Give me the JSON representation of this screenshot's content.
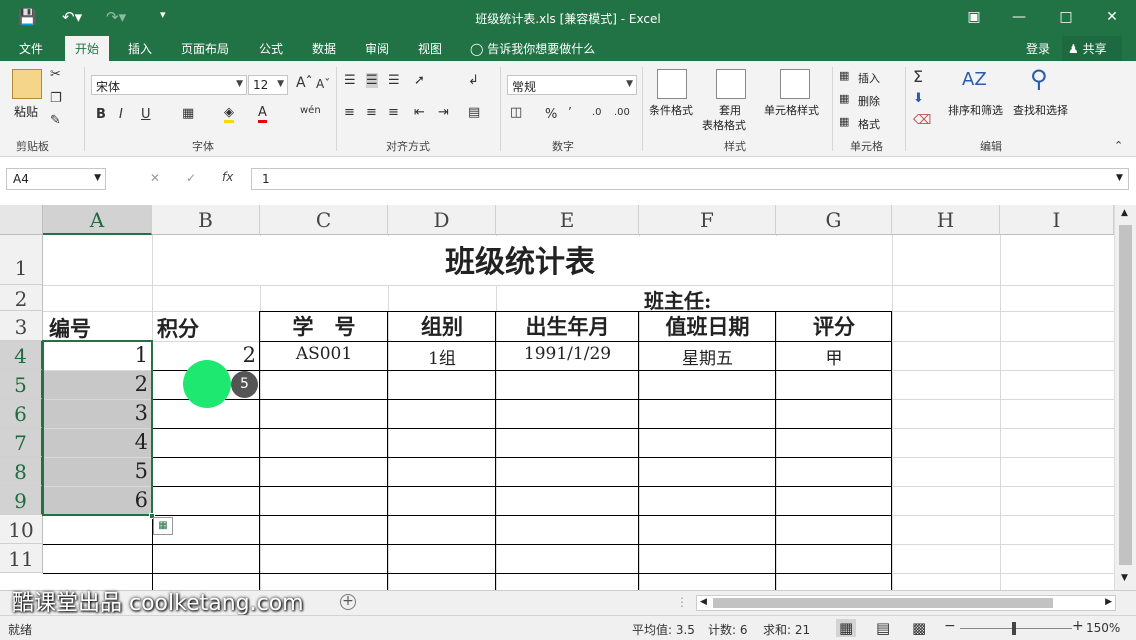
{
  "window": {
    "title": "班级统计表.xls  [兼容模式] - Excel"
  },
  "tabs": [
    "文件",
    "开始",
    "插入",
    "页面布局",
    "公式",
    "数据",
    "审阅",
    "视图"
  ],
  "active_tab": "开始",
  "tell_me": "告诉我你想要做什么",
  "login": "登录",
  "share": "共享",
  "ribbon": {
    "clipboard": {
      "paste": "粘贴",
      "label": "剪贴板"
    },
    "font": {
      "name": "宋体",
      "size": "12",
      "bold": "B",
      "italic": "I",
      "underline": "U",
      "label": "字体"
    },
    "alignment": {
      "label": "对齐方式"
    },
    "number": {
      "format": "常规",
      "label": "数字",
      "percent": "%"
    },
    "styles": {
      "conditional": "条件格式",
      "table_format_1": "套用",
      "table_format_2": "表格格式",
      "cell_styles": "单元格样式",
      "label": "样式"
    },
    "cells": {
      "insert": "插入",
      "delete": "删除",
      "format": "格式",
      "label": "单元格"
    },
    "editing": {
      "sort": "排序和筛选",
      "find": "查找和选择",
      "label": "编辑"
    }
  },
  "formula_bar": {
    "name_box": "A4",
    "fx": "fx",
    "value": "1"
  },
  "columns": [
    "A",
    "B",
    "C",
    "D",
    "E",
    "F",
    "G",
    "H",
    "I"
  ],
  "rows": [
    "1",
    "2",
    "3",
    "4",
    "5",
    "6",
    "7",
    "8",
    "9",
    "10",
    "11"
  ],
  "sheet": {
    "title": "班级统计表",
    "head_teacher": "班主任:",
    "headers": [
      "编号",
      "积分",
      "学　号",
      "组别",
      "出生年月",
      "值班日期",
      "评分"
    ],
    "row4": [
      "1",
      "2",
      "AS001",
      "1组",
      "1991/1/29",
      "星期五",
      "甲"
    ],
    "a_values": [
      "2",
      "3",
      "4",
      "5",
      "6"
    ]
  },
  "cursor_badge": "5",
  "watermark": "酷课堂出品 coolketang.com",
  "status": {
    "ready": "就绪",
    "average": "平均值: 3.5",
    "count": "计数: 6",
    "sum": "求和: 21",
    "zoom": "150%"
  }
}
